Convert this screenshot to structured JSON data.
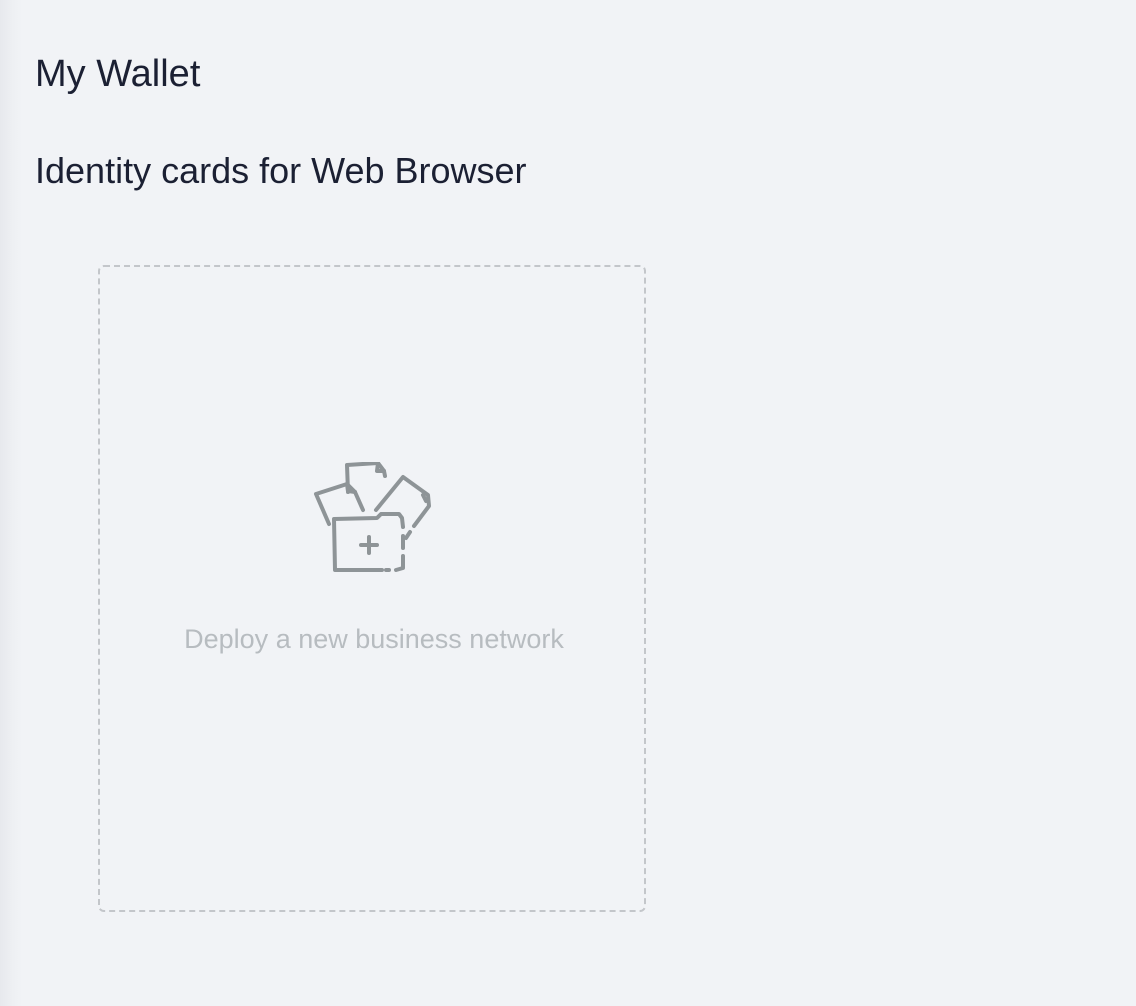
{
  "page": {
    "title": "My Wallet",
    "section_heading": "Identity cards for Web Browser"
  },
  "deploy_card": {
    "label": "Deploy a new business network",
    "icon": "folder-add-icon"
  },
  "colors": {
    "background": "#f1f3f6",
    "heading_text": "#1b2033",
    "card_border": "#c3c6ca",
    "icon_stroke": "#8e9497",
    "card_label": "#b7bcc0"
  }
}
